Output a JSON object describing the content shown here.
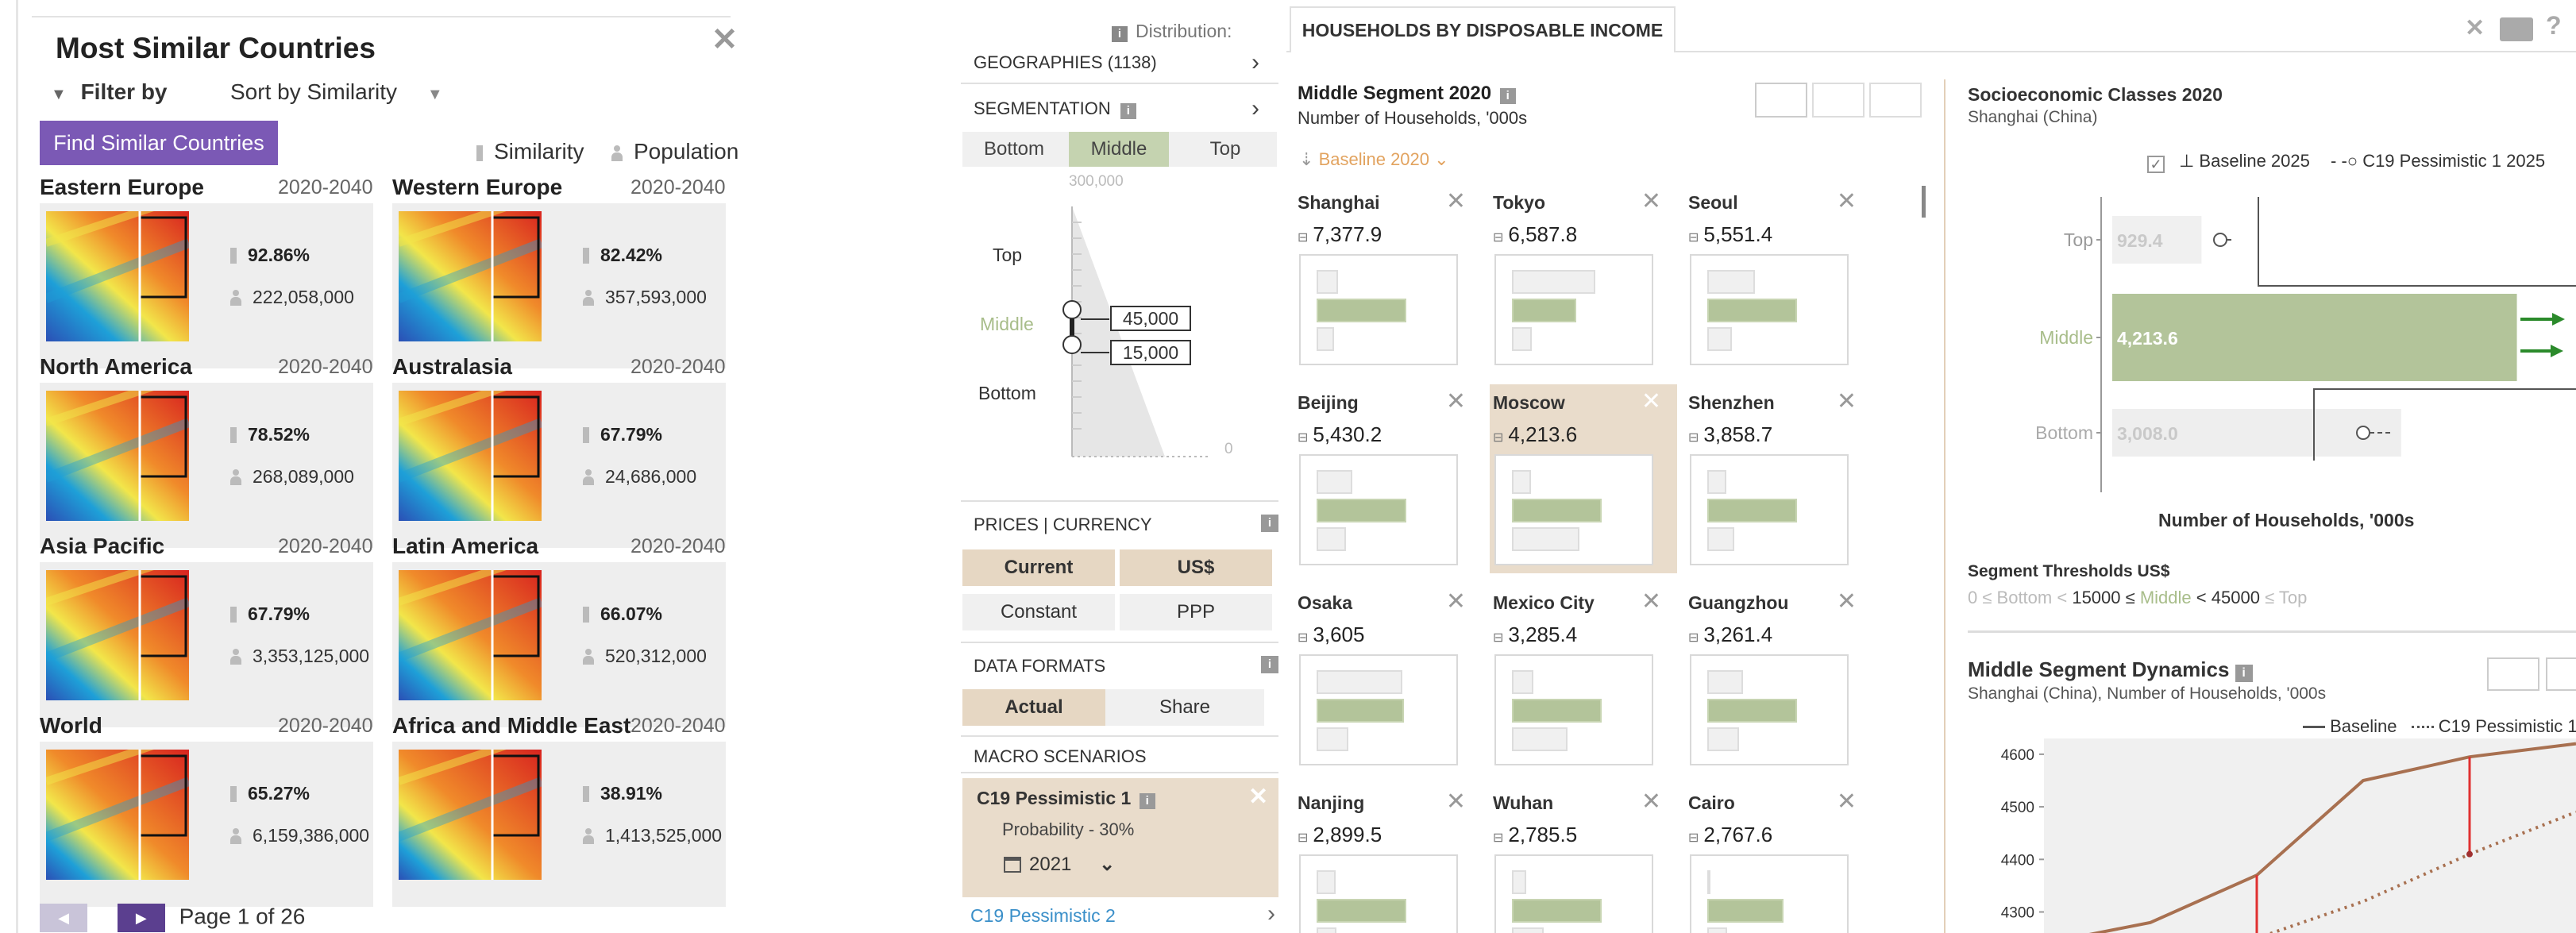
{
  "left": {
    "title": "Most Similar Countries",
    "filter_label": "Filter by",
    "sort_label": "Sort by Similarity",
    "find_button": "Find Similar Countries",
    "legend_similarity": "Similarity",
    "legend_population": "Population",
    "tiles": [
      {
        "name": "Eastern Europe",
        "years": "2020-2040",
        "similarity": "92.86%",
        "population": "222,058,000"
      },
      {
        "name": "Western Europe",
        "years": "2020-2040",
        "similarity": "82.42%",
        "population": "357,593,000"
      },
      {
        "name": "North America",
        "years": "2020-2040",
        "similarity": "78.52%",
        "population": "268,089,000"
      },
      {
        "name": "Australasia",
        "years": "2020-2040",
        "similarity": "67.79%",
        "population": "24,686,000"
      },
      {
        "name": "Asia Pacific",
        "years": "2020-2040",
        "similarity": "67.79%",
        "population": "3,353,125,000"
      },
      {
        "name": "Latin America",
        "years": "2020-2040",
        "similarity": "66.07%",
        "population": "520,312,000"
      },
      {
        "name": "World",
        "years": "2020-2040",
        "similarity": "65.27%",
        "population": "6,159,386,000"
      },
      {
        "name": "Africa and Middle East",
        "years": "2020-2040",
        "similarity": "38.91%",
        "population": "1,413,525,000"
      }
    ],
    "page_text": "Page 1 of 26",
    "prev_glyph": "◀",
    "next_glyph": "▶"
  },
  "config": {
    "distribution_label": "Distribution:",
    "geographies": "GEOGRAPHIES (1138)",
    "segmentation": "SEGMENTATION",
    "seg_tabs": [
      "Bottom",
      "Middle",
      "Top"
    ],
    "slider_max": "300,000",
    "slider_min": "0",
    "slider_labels": [
      "Top",
      "Middle",
      "Bottom"
    ],
    "threshold_upper": "45,000",
    "threshold_lower": "15,000",
    "prices_currency": "PRICES | CURRENCY",
    "price_options": [
      "Current",
      "US$",
      "Constant",
      "PPP"
    ],
    "data_formats": "DATA FORMATS",
    "format_options": [
      "Actual",
      "Share"
    ],
    "macro_scenarios": "MACRO SCENARIOS",
    "scenario_name": "C19 Pessimistic 1",
    "scenario_probability": "Probability - 30%",
    "scenario_year": "2021",
    "scenario_next": "C19 Pessimistic 2"
  },
  "header": {
    "active_tab": "HOUSEHOLDS BY DISPOSABLE INCOME"
  },
  "segment": {
    "title": "Middle Segment 2020",
    "subtitle": "Number of Households, '000s",
    "baseline_label": "Baseline 2020",
    "cities": [
      {
        "name": "Shanghai",
        "value": "7,377.9",
        "top": 0.18,
        "mid": 0.72,
        "bot": 0.08
      },
      {
        "name": "Tokyo",
        "value": "6,587.8",
        "top": 0.7,
        "mid": 0.5,
        "bot": 0.1
      },
      {
        "name": "Seoul",
        "value": "5,551.4",
        "top": 0.4,
        "mid": 0.72,
        "bot": 0.14
      },
      {
        "name": "Beijing",
        "value": "5,430.2",
        "top": 0.3,
        "mid": 0.72,
        "bot": 0.18
      },
      {
        "name": "Moscow",
        "value": "4,213.6",
        "top": 0.16,
        "mid": 0.72,
        "bot": 0.5
      },
      {
        "name": "Shenzhen",
        "value": "3,858.7",
        "top": 0.16,
        "mid": 0.72,
        "bot": 0.16
      },
      {
        "name": "Osaka",
        "value": "3,605",
        "top": 0.72,
        "mid": 0.7,
        "bot": 0.2
      },
      {
        "name": "Mexico City",
        "value": "3,285.4",
        "top": 0.18,
        "mid": 0.72,
        "bot": 0.4
      },
      {
        "name": "Guangzhou",
        "value": "3,261.4",
        "top": 0.3,
        "mid": 0.72,
        "bot": 0.2
      },
      {
        "name": "Nanjing",
        "value": "2,899.5",
        "top": 0.16,
        "mid": 0.72,
        "bot": 0.1
      },
      {
        "name": "Wuhan",
        "value": "2,785.5",
        "top": 0.12,
        "mid": 0.72,
        "bot": 0.2
      },
      {
        "name": "Cairo",
        "value": "2,767.6",
        "top": 0.02,
        "mid": 0.6,
        "bot": 0.1
      }
    ]
  },
  "socio": {
    "title": "Socioeconomic Classes 2020",
    "subtitle": "Shanghai (China)",
    "legend_baseline": "Baseline 2025",
    "legend_scenario": "C19 Pessimistic 1 2025",
    "xlabel": "Number of Households, '000s",
    "thresholds_title": "Segment Thresholds US$",
    "threshold_prefix": "0 ≤ Bottom <",
    "threshold_low": "15000",
    "threshold_le": "≤",
    "threshold_mid": "Middle",
    "threshold_lt": "<",
    "threshold_high": "45000",
    "threshold_suffix": "≤ Top"
  },
  "dynamics": {
    "title": "Middle Segment Dynamics",
    "subtitle": "Shanghai (China), Number of Households, '000s",
    "legend_baseline": "Baseline",
    "legend_scenario": "C19 Pessimistic 1"
  },
  "chart_data": [
    {
      "type": "bar",
      "title": "Socioeconomic Classes 2020",
      "categories": [
        "Top",
        "Middle",
        "Bottom"
      ],
      "values": [
        929.4,
        4213.6,
        3008.0
      ],
      "xlabel": "Number of Households, '000s"
    },
    {
      "type": "line",
      "title": "Middle Segment Dynamics",
      "yticks": [
        4300,
        4400,
        4500,
        4600
      ],
      "series": [
        {
          "name": "Baseline",
          "values": [
            4240,
            4280,
            4370,
            4550,
            4595,
            4620
          ]
        },
        {
          "name": "C19 Pessimistic 1",
          "values": [
            null,
            null,
            4250,
            4320,
            4410,
            4490
          ]
        }
      ]
    }
  ]
}
